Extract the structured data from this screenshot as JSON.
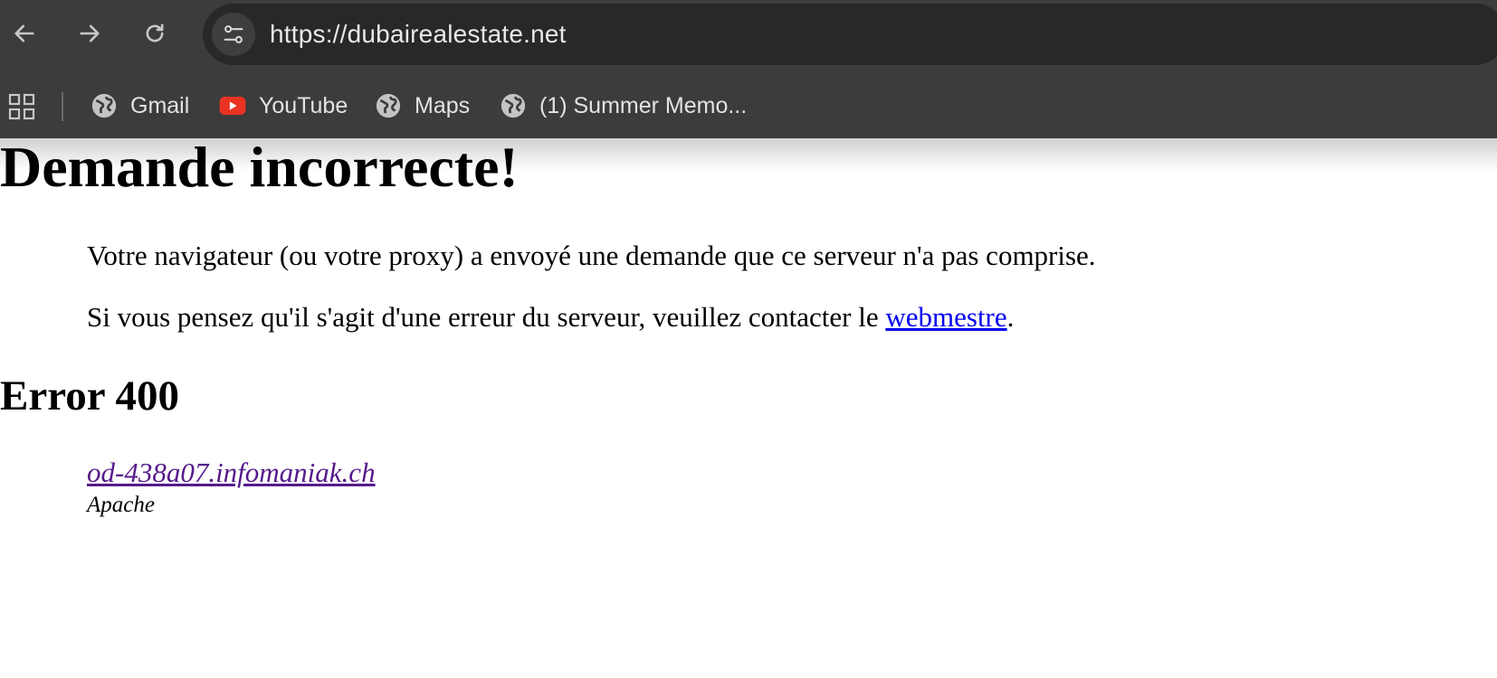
{
  "browser": {
    "url": "https://dubairealestate.net",
    "bookmarks": [
      {
        "label": "Gmail",
        "icon": "globe-icon"
      },
      {
        "label": "YouTube",
        "icon": "youtube-icon"
      },
      {
        "label": "Maps",
        "icon": "globe-icon"
      },
      {
        "label": "(1) Summer Memo...",
        "icon": "globe-icon"
      }
    ],
    "colors": {
      "chrome": "#3c3c3c",
      "omnibox": "#282828",
      "youtube": "#ea3323"
    }
  },
  "page": {
    "title": "Demande incorrecte!",
    "message_1": "Votre navigateur (ou votre proxy) a envoyé une demande que ce serveur n'a pas comprise.",
    "message_2_prefix": "Si vous pensez qu'il s'agit d'une erreur du serveur, veuillez contacter le ",
    "message_2_link": "webmestre",
    "message_2_suffix": ".",
    "error_heading": "Error 400",
    "server_host": "od-438a07.infomaniak.ch",
    "server_software": "Apache"
  }
}
